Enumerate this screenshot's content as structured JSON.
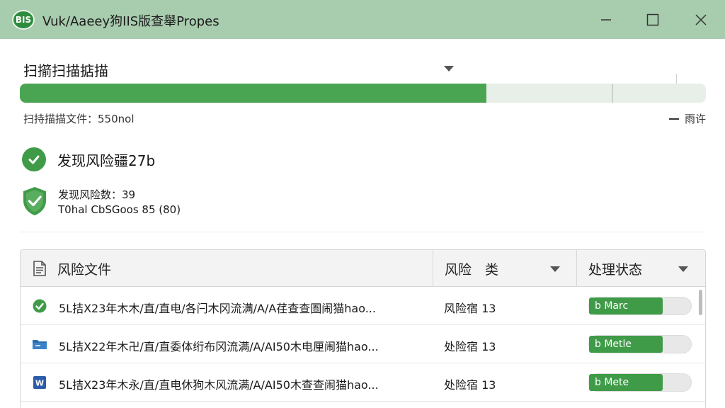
{
  "window": {
    "logo_text": "BIS",
    "title": "Vuk/Aaeey狗IIS版查舉Propes"
  },
  "scan": {
    "selector_label": "扫擶扫描掂描",
    "progress_fraction": 0.68,
    "scanned_text": "扫持描描文件：550nol",
    "detail_label": "雨许"
  },
  "result": {
    "found_title": "发现风险疆27b",
    "risk_count": "发现风险数：39",
    "total_text": "T0hal CbSGoos 85 (80)"
  },
  "table": {
    "columns": {
      "file": "风险文件",
      "risk": "风险　类",
      "status": "处理状态"
    },
    "rows": [
      {
        "icon": "check-icon",
        "path": "5L拮X23年木木/直/直电/各闩木冈流满/A/A荏查查圄闹猫hao...",
        "risk": "风险宿 13",
        "action": "b Marc"
      },
      {
        "icon": "folder-icon",
        "path": "5L拮X22年木卍/直/直委体绗布冈流满/A/AI50木电厘闹猫hao...",
        "risk": "处险宿 13",
        "action": "b Metle"
      },
      {
        "icon": "word-doc-icon",
        "path": "5L拮X23年木永/直/直电休狗木风流满/A/AI50木查查闹猫hao...",
        "risk": "处险宿 13",
        "action": "b Mete"
      }
    ]
  },
  "colors": {
    "titlebar": "#a8ccae",
    "accent_green": "#4aa552",
    "dark_green": "#3f9b48"
  }
}
